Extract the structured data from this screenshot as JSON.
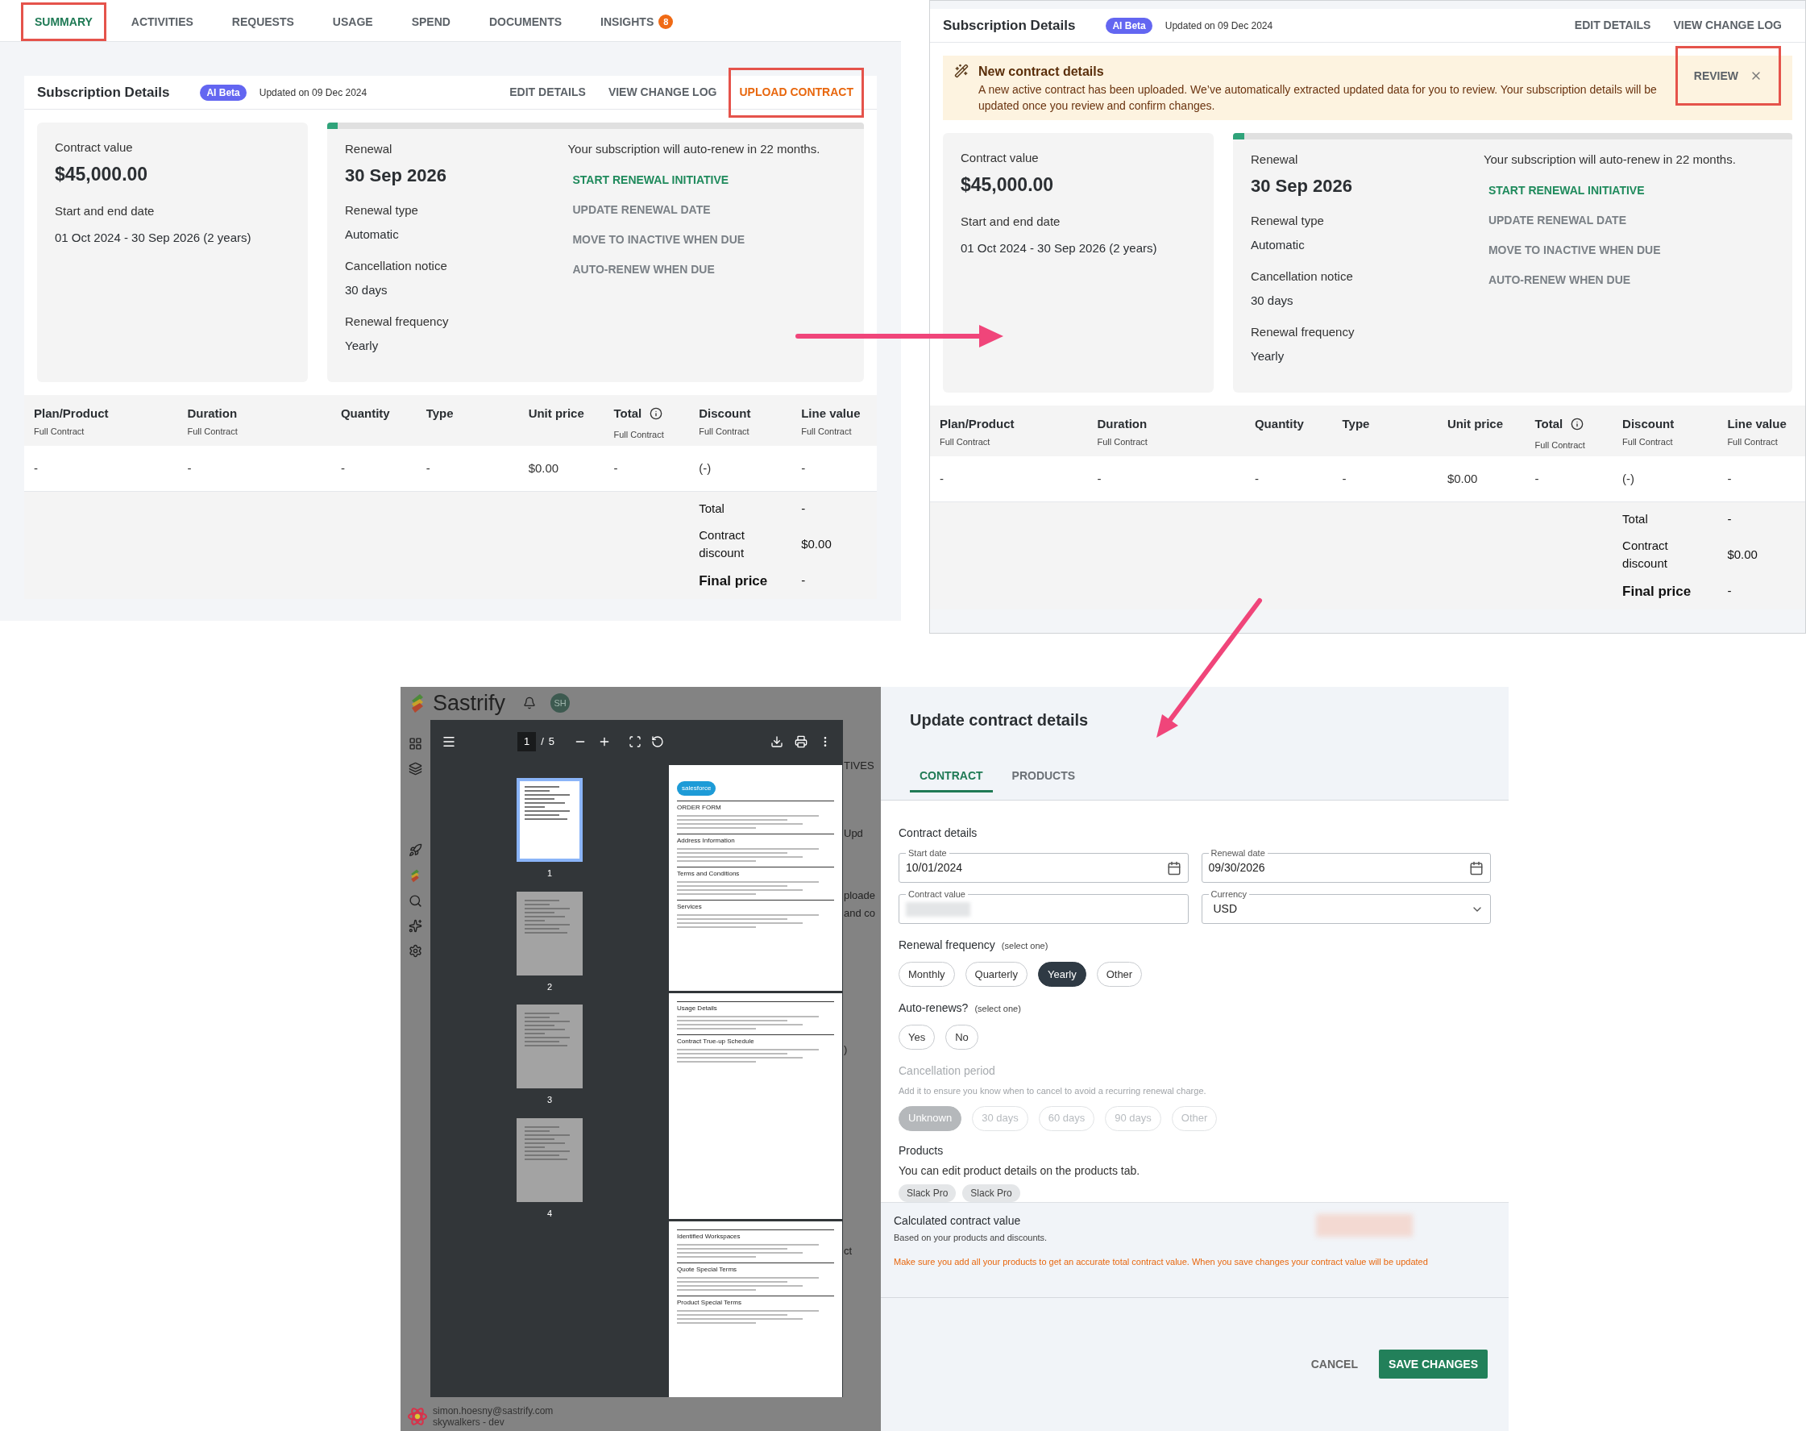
{
  "summary_view": {
    "tabs": [
      {
        "label": "SUMMARY",
        "selected": true,
        "highlighted": true
      },
      {
        "label": "ACTIVITIES",
        "selected": false,
        "highlighted": false
      },
      {
        "label": "REQUESTS",
        "selected": false,
        "highlighted": false
      },
      {
        "label": "USAGE",
        "selected": false,
        "highlighted": false
      },
      {
        "label": "SPEND",
        "selected": false,
        "highlighted": false
      },
      {
        "label": "DOCUMENTS",
        "selected": false,
        "highlighted": false
      },
      {
        "label": "INSIGHTS",
        "selected": false,
        "highlighted": false,
        "badge": "8"
      }
    ],
    "subscription": {
      "title": "Subscription Details",
      "badge": "AI Beta",
      "updated": "Updated on 09 Dec 2024",
      "actions": [
        {
          "label": "EDIT DETAILS",
          "kind": "plain",
          "highlighted": false
        },
        {
          "label": "VIEW CHANGE LOG",
          "kind": "plain",
          "highlighted": false
        },
        {
          "label": "UPLOAD CONTRACT",
          "kind": "accent",
          "highlighted": true
        }
      ],
      "contract": {
        "label": "Contract value",
        "value": "$45,000.00",
        "dates_label": "Start and end date",
        "dates": "01 Oct 2024 - 30 Sep 2026 (2 years)"
      },
      "renewal": {
        "level": 0.02,
        "fields": [
          {
            "label": "Renewal",
            "value": "30 Sep 2026",
            "kind": "large"
          },
          {
            "label": "Renewal type",
            "value": "Automatic",
            "kind": "normal"
          },
          {
            "label": "Cancellation notice",
            "value": "30 days",
            "kind": "normal"
          },
          {
            "label": "Renewal frequency",
            "value": "Yearly",
            "kind": "normal"
          }
        ],
        "note": "Your subscription will auto-renew in 22 months.",
        "actions": [
          {
            "label": "START RENEWAL INITIATIVE",
            "primary": true
          },
          {
            "label": "UPDATE RENEWAL DATE",
            "primary": false
          },
          {
            "label": "MOVE TO INACTIVE WHEN DUE",
            "primary": false
          },
          {
            "label": "AUTO-RENEW WHEN DUE",
            "primary": false
          }
        ]
      },
      "table": {
        "columns": [
          {
            "label": "Plan/Product",
            "sub": "Full Contract"
          },
          {
            "label": "Duration",
            "sub": "Full Contract"
          },
          {
            "label": "Quantity"
          },
          {
            "label": "Type"
          },
          {
            "label": "Unit price"
          },
          {
            "label": "Total",
            "sub": "Full Contract",
            "info": true
          },
          {
            "label": "Discount",
            "sub": "Full Contract"
          },
          {
            "label": "Line value",
            "sub": "Full Contract"
          }
        ],
        "rows": [
          [
            "-",
            "-",
            "-",
            "-",
            "$0.00",
            "-",
            "(-)",
            "-"
          ]
        ],
        "totals": [
          {
            "label": "Total",
            "value": "-",
            "kind": "normal"
          },
          {
            "label": "Contract discount",
            "value": "$0.00",
            "kind": "normal"
          },
          {
            "label": "Final price",
            "value": "-",
            "kind": "final"
          }
        ]
      }
    }
  },
  "review_view": {
    "subscription": {
      "title": "Subscription Details",
      "badge": "AI Beta",
      "updated": "Updated on 09 Dec 2024",
      "actions": [
        {
          "label": "EDIT DETAILS",
          "kind": "plain",
          "highlighted": false
        },
        {
          "label": "VIEW CHANGE LOG",
          "kind": "plain",
          "highlighted": false
        }
      ],
      "banner": {
        "title": "New contract details",
        "text": "A new active contract has been uploaded. We’ve automatically extracted updated data for you to review. Your subscription details will be updated once you review and confirm changes.",
        "action": "REVIEW",
        "highlighted": true
      },
      "contract": {
        "label": "Contract value",
        "value": "$45,000.00",
        "dates_label": "Start and end date",
        "dates": "01 Oct 2024 - 30 Sep 2026 (2 years)"
      },
      "renewal": {
        "level": 0.02,
        "fields": [
          {
            "label": "Renewal",
            "value": "30 Sep 2026",
            "kind": "large"
          },
          {
            "label": "Renewal type",
            "value": "Automatic",
            "kind": "normal"
          },
          {
            "label": "Cancellation notice",
            "value": "30 days",
            "kind": "normal"
          },
          {
            "label": "Renewal frequency",
            "value": "Yearly",
            "kind": "normal"
          }
        ],
        "note": "Your subscription will auto-renew in 22 months.",
        "actions": [
          {
            "label": "START RENEWAL INITIATIVE",
            "primary": true
          },
          {
            "label": "UPDATE RENEWAL DATE",
            "primary": false
          },
          {
            "label": "MOVE TO INACTIVE WHEN DUE",
            "primary": false
          },
          {
            "label": "AUTO-RENEW WHEN DUE",
            "primary": false
          }
        ]
      },
      "table": {
        "columns": [
          {
            "label": "Plan/Product",
            "sub": "Full Contract"
          },
          {
            "label": "Duration",
            "sub": "Full Contract"
          },
          {
            "label": "Quantity"
          },
          {
            "label": "Type"
          },
          {
            "label": "Unit price"
          },
          {
            "label": "Total",
            "sub": "Full Contract",
            "info": true
          },
          {
            "label": "Discount",
            "sub": "Full Contract"
          },
          {
            "label": "Line value",
            "sub": "Full Contract"
          }
        ],
        "rows": [
          [
            "-",
            "-",
            "-",
            "-",
            "$0.00",
            "-",
            "(-)",
            "-"
          ]
        ],
        "totals": [
          {
            "label": "Total",
            "value": "-",
            "kind": "normal"
          },
          {
            "label": "Contract discount",
            "value": "$0.00",
            "kind": "normal"
          },
          {
            "label": "Final price",
            "value": "-",
            "kind": "final"
          }
        ]
      }
    }
  },
  "document_viewer": {
    "app": {
      "brand": "Sastrify",
      "avatar": "SH",
      "user_email": "simon.hoesny@sastrify.com",
      "workspace": "skywalkers - dev",
      "background_fragments": [
        "TIVES",
        "Upd",
        "ploade",
        "and co",
        ")",
        "ct"
      ]
    },
    "toolbar": {
      "page": "1",
      "separator": "/",
      "total": "5"
    },
    "thumbnails": [
      {
        "label": "1",
        "selected": true
      },
      {
        "label": "2",
        "selected": false
      },
      {
        "label": "3",
        "selected": false
      },
      {
        "label": "4",
        "selected": false
      }
    ],
    "pages": [
      {
        "logo_text": "salesforce",
        "headings": [
          "ORDER FORM",
          "Address Information",
          "Terms and Conditions",
          "Services"
        ]
      },
      {
        "headings": [
          "Usage Details",
          "Contract True-up Schedule"
        ]
      },
      {
        "headings": [
          "Identified Workspaces",
          "Quote Special Terms",
          "Product Special Terms"
        ]
      }
    ]
  },
  "contract_editor": {
    "title": "Update contract details",
    "tabs": [
      {
        "label": "CONTRACT",
        "selected": true
      },
      {
        "label": "PRODUCTS",
        "selected": false
      }
    ],
    "section": "Contract details",
    "fields": [
      {
        "label": "Start date",
        "value": "10/01/2024",
        "kind": "date"
      },
      {
        "label": "Renewal date",
        "value": "09/30/2026",
        "kind": "date"
      },
      {
        "label": "Contract value",
        "kind": "blurred"
      },
      {
        "label": "Currency",
        "value": "USD",
        "kind": "select"
      }
    ],
    "groups": [
      {
        "title": "Renewal frequency",
        "hint": "(select one)",
        "disabled": false,
        "options": [
          {
            "label": "Monthly",
            "selected": false
          },
          {
            "label": "Quarterly",
            "selected": false
          },
          {
            "label": "Yearly",
            "selected": true
          },
          {
            "label": "Other",
            "selected": false
          }
        ]
      },
      {
        "title": "Auto-renews?",
        "hint": "(select one)",
        "disabled": false,
        "options": [
          {
            "label": "Yes",
            "selected": false
          },
          {
            "label": "No",
            "selected": false
          }
        ]
      },
      {
        "title": "Cancellation period",
        "description": "Add it to ensure you know when to cancel to avoid a recurring renewal charge.",
        "disabled": true,
        "options": [
          {
            "label": "Unknown",
            "selected": true
          },
          {
            "label": "30 days",
            "selected": false
          },
          {
            "label": "60 days",
            "selected": false
          },
          {
            "label": "90 days",
            "selected": false
          },
          {
            "label": "Other",
            "selected": false
          }
        ]
      }
    ],
    "products": {
      "title": "Products",
      "text": "You can edit product details on the products tab.",
      "chips": [
        "Slack Pro",
        "Slack Pro"
      ]
    },
    "calculated": {
      "title": "Calculated contract value",
      "subtitle": "Based on your products and discounts.",
      "warning": "Make sure you add all your products to get an accurate total contract value. When you save changes your contract value will be updated"
    },
    "buttons": [
      {
        "label": "CANCEL",
        "kind": "text"
      },
      {
        "label": "SAVE CHANGES",
        "kind": "primary"
      }
    ]
  }
}
